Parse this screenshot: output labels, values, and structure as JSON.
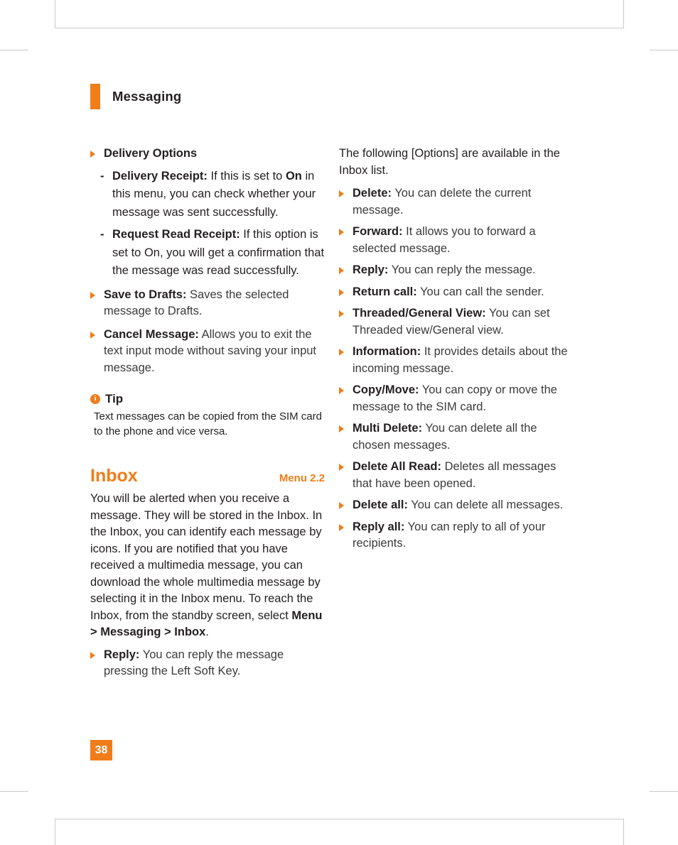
{
  "header": {
    "title": "Messaging"
  },
  "page_number": "38",
  "left_column": {
    "delivery_options": {
      "label": "Delivery Options",
      "sub_items": [
        {
          "dash": "-",
          "term": "Delivery Receipt:",
          "text_before_bold": " If this is set to ",
          "bold_value": "On",
          "text_after_bold": " in this menu, you can check whether your message was sent successfully."
        },
        {
          "dash": "-",
          "term": "Request Read Receipt:",
          "text": " If this option is set to On, you will get a confirmation that the message was read successfully."
        }
      ]
    },
    "bullets": [
      {
        "term": "Save to Drafts:",
        "text": " Saves the selected message to Drafts."
      },
      {
        "term": "Cancel Message:",
        "text": " Allows you to exit the text input mode without saving your input message."
      }
    ],
    "tip": {
      "icon": "info-icon",
      "icon_glyph": "i",
      "title": "Tip",
      "body": "Text messages can be copied from the SIM card to the phone and vice versa."
    },
    "section": {
      "title": "Inbox",
      "menu_ref": "Menu 2.2",
      "paragraph_part1": "You will be alerted when you receive a message. They will be stored in the Inbox. In the Inbox, you can identify each message by icons. If you are notified that you have received a multimedia message, you can download the whole multimedia message by selecting it in the Inbox menu. To reach the Inbox, from the standby screen, select ",
      "paragraph_bold": "Menu > Messaging > Inbox",
      "paragraph_part2": ".",
      "bullets": [
        {
          "term": "Reply:",
          "text": " You can reply the message pressing the Left Soft Key."
        }
      ]
    }
  },
  "right_column": {
    "intro": "The following [Options] are available in the Inbox list.",
    "options": [
      {
        "term": "Delete:",
        "text": " You can delete the current message."
      },
      {
        "term": "Forward:",
        "text": " It allows you to forward a selected message."
      },
      {
        "term": "Reply:",
        "text": " You can reply the message."
      },
      {
        "term": "Return call:",
        "text": " You can call the sender."
      },
      {
        "term": "Threaded/General View:",
        "text": " You can set Threaded view/General view."
      },
      {
        "term": "Information:",
        "text": " It provides details about the incoming message."
      },
      {
        "term": "Copy/Move:",
        "text": " You can copy or move the message to the SIM card."
      },
      {
        "term": "Multi Delete:",
        "text": " You can delete all the chosen messages."
      },
      {
        "term": "Delete All Read:",
        "text": " Deletes all messages that have been opened."
      },
      {
        "term": "Delete all:",
        "text": " You can delete all messages."
      },
      {
        "term": "Reply all:",
        "text": " You can reply to all of your recipients."
      }
    ]
  },
  "colors": {
    "accent": "#f07d1a",
    "text": "#231f20",
    "frame": "#c8c9cb"
  }
}
